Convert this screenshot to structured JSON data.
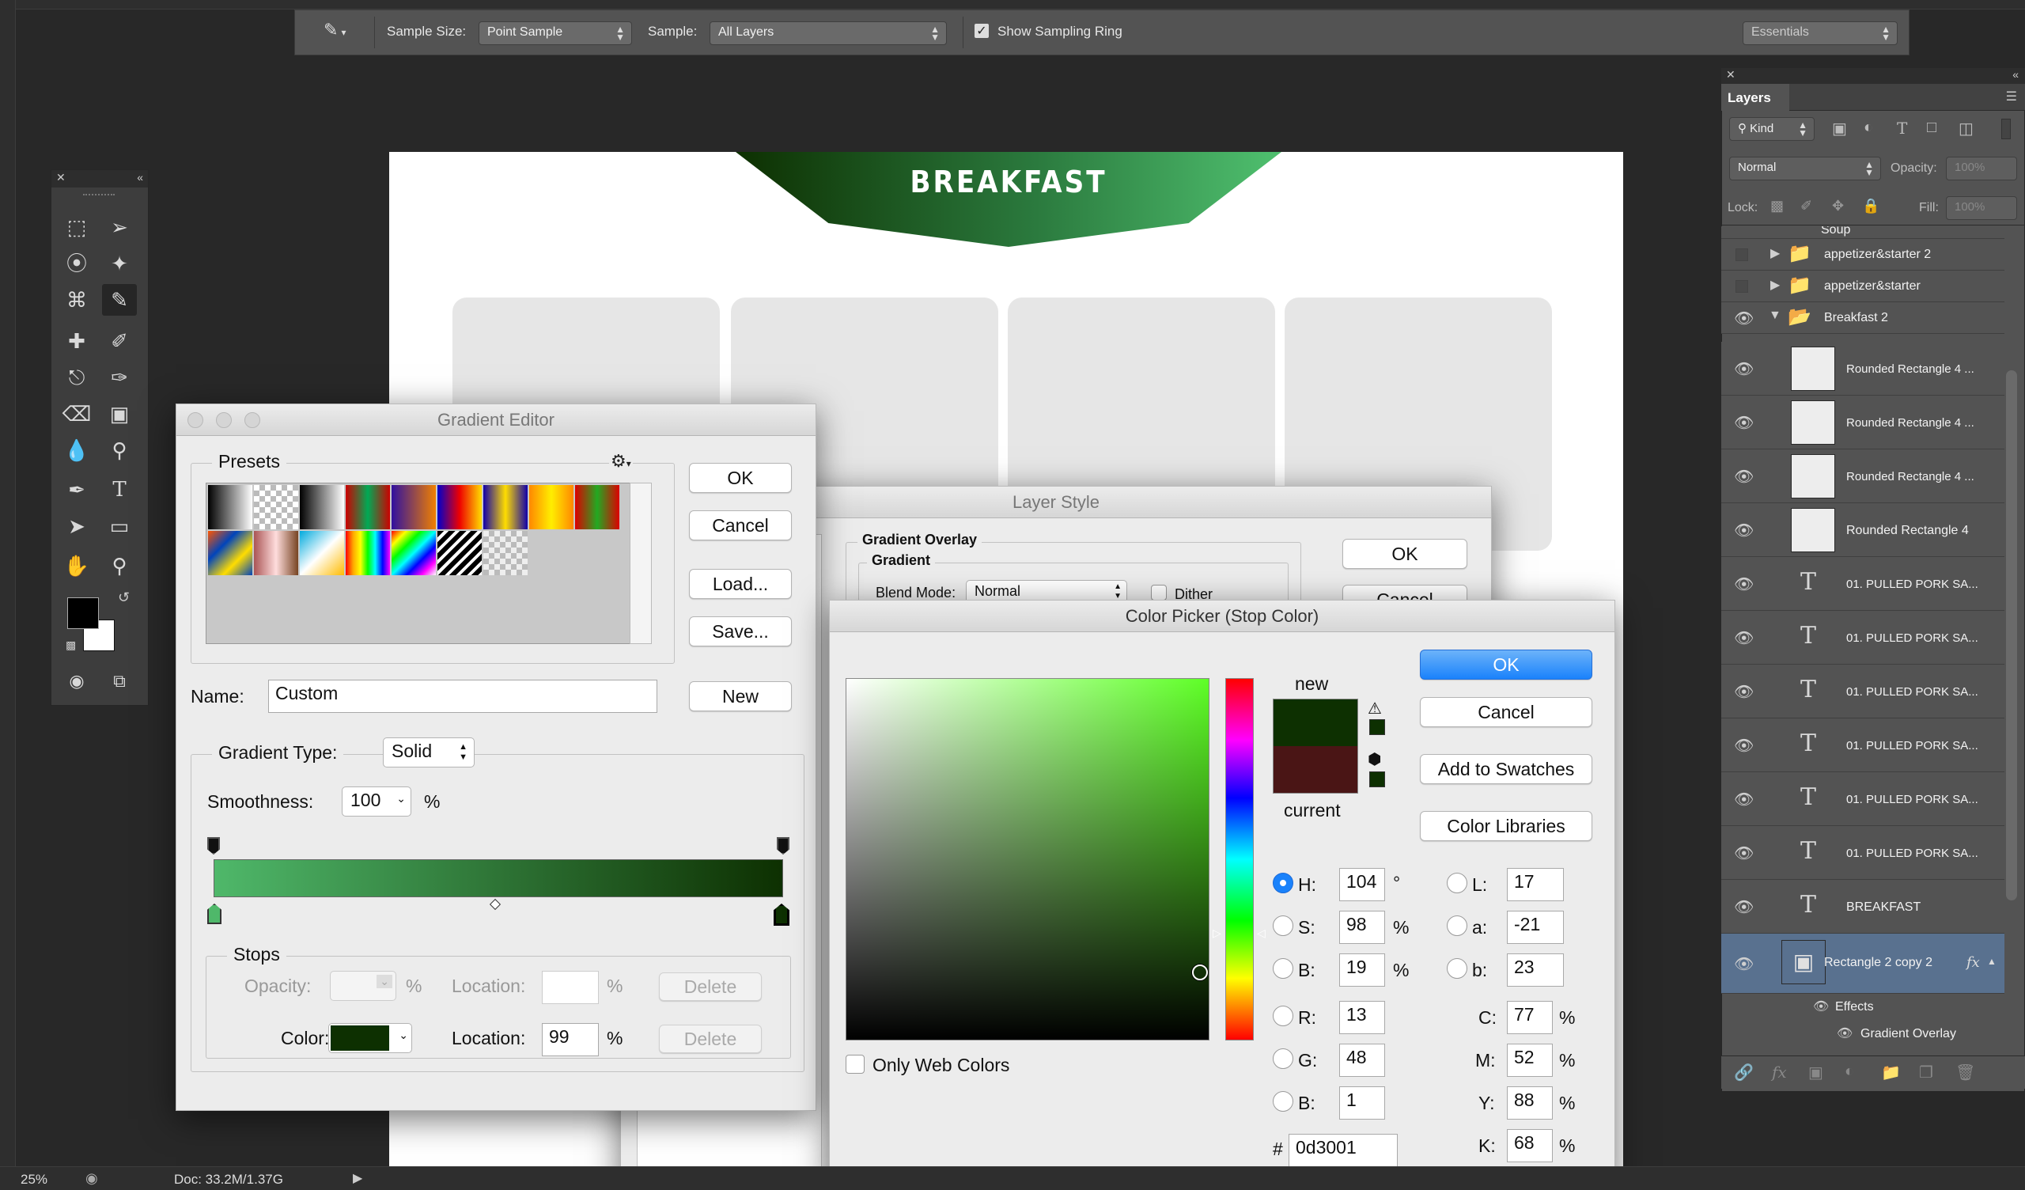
{
  "options_bar": {
    "sample_size_label": "Sample Size:",
    "sample_size_value": "Point Sample",
    "sample_label": "Sample:",
    "sample_value": "All Layers",
    "show_sampling_ring_label": "Show Sampling Ring",
    "workspace_value": "Essentials"
  },
  "canvas": {
    "banner_title": "BREAKFAST"
  },
  "gradient_editor": {
    "title": "Gradient Editor",
    "presets_label": "Presets",
    "ok_label": "OK",
    "cancel_label": "Cancel",
    "load_label": "Load...",
    "save_label": "Save...",
    "name_label": "Name:",
    "name_value": "Custom",
    "new_label": "New",
    "gradient_type_label": "Gradient Type:",
    "gradient_type_value": "Solid",
    "smoothness_label": "Smoothness:",
    "smoothness_value": "100",
    "percent": "%",
    "stops_label": "Stops",
    "opacity_label": "Opacity:",
    "location_label": "Location:",
    "delete_label": "Delete",
    "color_label": "Color:",
    "color_location_value": "99",
    "gradient_start_color": "#4fb86a",
    "gradient_end_color": "#0d3001"
  },
  "layer_style": {
    "title": "Layer Style",
    "section_label": "Gradient Overlay",
    "subsection_label": "Gradient",
    "blend_mode_label": "Blend Mode:",
    "blend_mode_value": "Normal",
    "dither_label": "Dither",
    "ok_label": "OK",
    "cancel_label": "Cancel"
  },
  "color_picker": {
    "title": "Color Picker (Stop Color)",
    "ok_label": "OK",
    "cancel_label": "Cancel",
    "add_to_swatches_label": "Add to Swatches",
    "color_libraries_label": "Color Libraries",
    "new_label": "new",
    "current_label": "current",
    "new_color": "#0d3001",
    "current_color": "#4a1515",
    "only_web_colors_label": "Only Web Colors",
    "h_label": "H:",
    "h_value": "104",
    "h_unit": "°",
    "s_label": "S:",
    "s_value": "98",
    "s_unit": "%",
    "b_label": "B:",
    "b_value": "19",
    "b_unit": "%",
    "r_label": "R:",
    "r_value": "13",
    "g_label": "G:",
    "g_value": "48",
    "bl_label": "B:",
    "bl_value": "1",
    "l_label": "L:",
    "l_value": "17",
    "a_label": "a:",
    "a_value": "-21",
    "lab_b_label": "b:",
    "lab_b_value": "23",
    "c_label": "C:",
    "c_value": "77",
    "m_label": "M:",
    "m_value": "52",
    "y_label": "Y:",
    "y_value": "88",
    "k_label": "K:",
    "k_value": "68",
    "percent": "%",
    "hash": "#",
    "hex_value": "0d3001",
    "hue_base": "#5eff26"
  },
  "layers_panel": {
    "tab_label": "Layers",
    "kind_label": "Kind",
    "blend_value": "Normal",
    "opacity_label": "Opacity:",
    "opacity_value": "100%",
    "lock_label": "Lock:",
    "fill_label": "Fill:",
    "fill_value": "100%",
    "partial_top": "Soup",
    "rows": [
      {
        "name": "appetizer&starter 2"
      },
      {
        "name": "appetizer&starter"
      },
      {
        "name": "Breakfast 2"
      },
      {
        "name": "Rounded Rectangle 4 ..."
      },
      {
        "name": "Rounded Rectangle 4 ..."
      },
      {
        "name": "Rounded Rectangle 4 ..."
      },
      {
        "name": "Rounded Rectangle 4"
      },
      {
        "name": "01. PULLED PORK SA..."
      },
      {
        "name": "01. PULLED PORK SA..."
      },
      {
        "name": "01. PULLED PORK SA..."
      },
      {
        "name": "01. PULLED PORK SA..."
      },
      {
        "name": "01. PULLED PORK SA..."
      },
      {
        "name": "01. PULLED PORK SA..."
      },
      {
        "name": "BREAKFAST"
      },
      {
        "name": "Rectangle 2 copy 2"
      }
    ],
    "effects_label": "Effects",
    "gradient_overlay_label": "Gradient Overlay",
    "fx_label": "fx"
  },
  "status_bar": {
    "zoom": "25%",
    "doc": "Doc: 33.2M/1.37G"
  }
}
